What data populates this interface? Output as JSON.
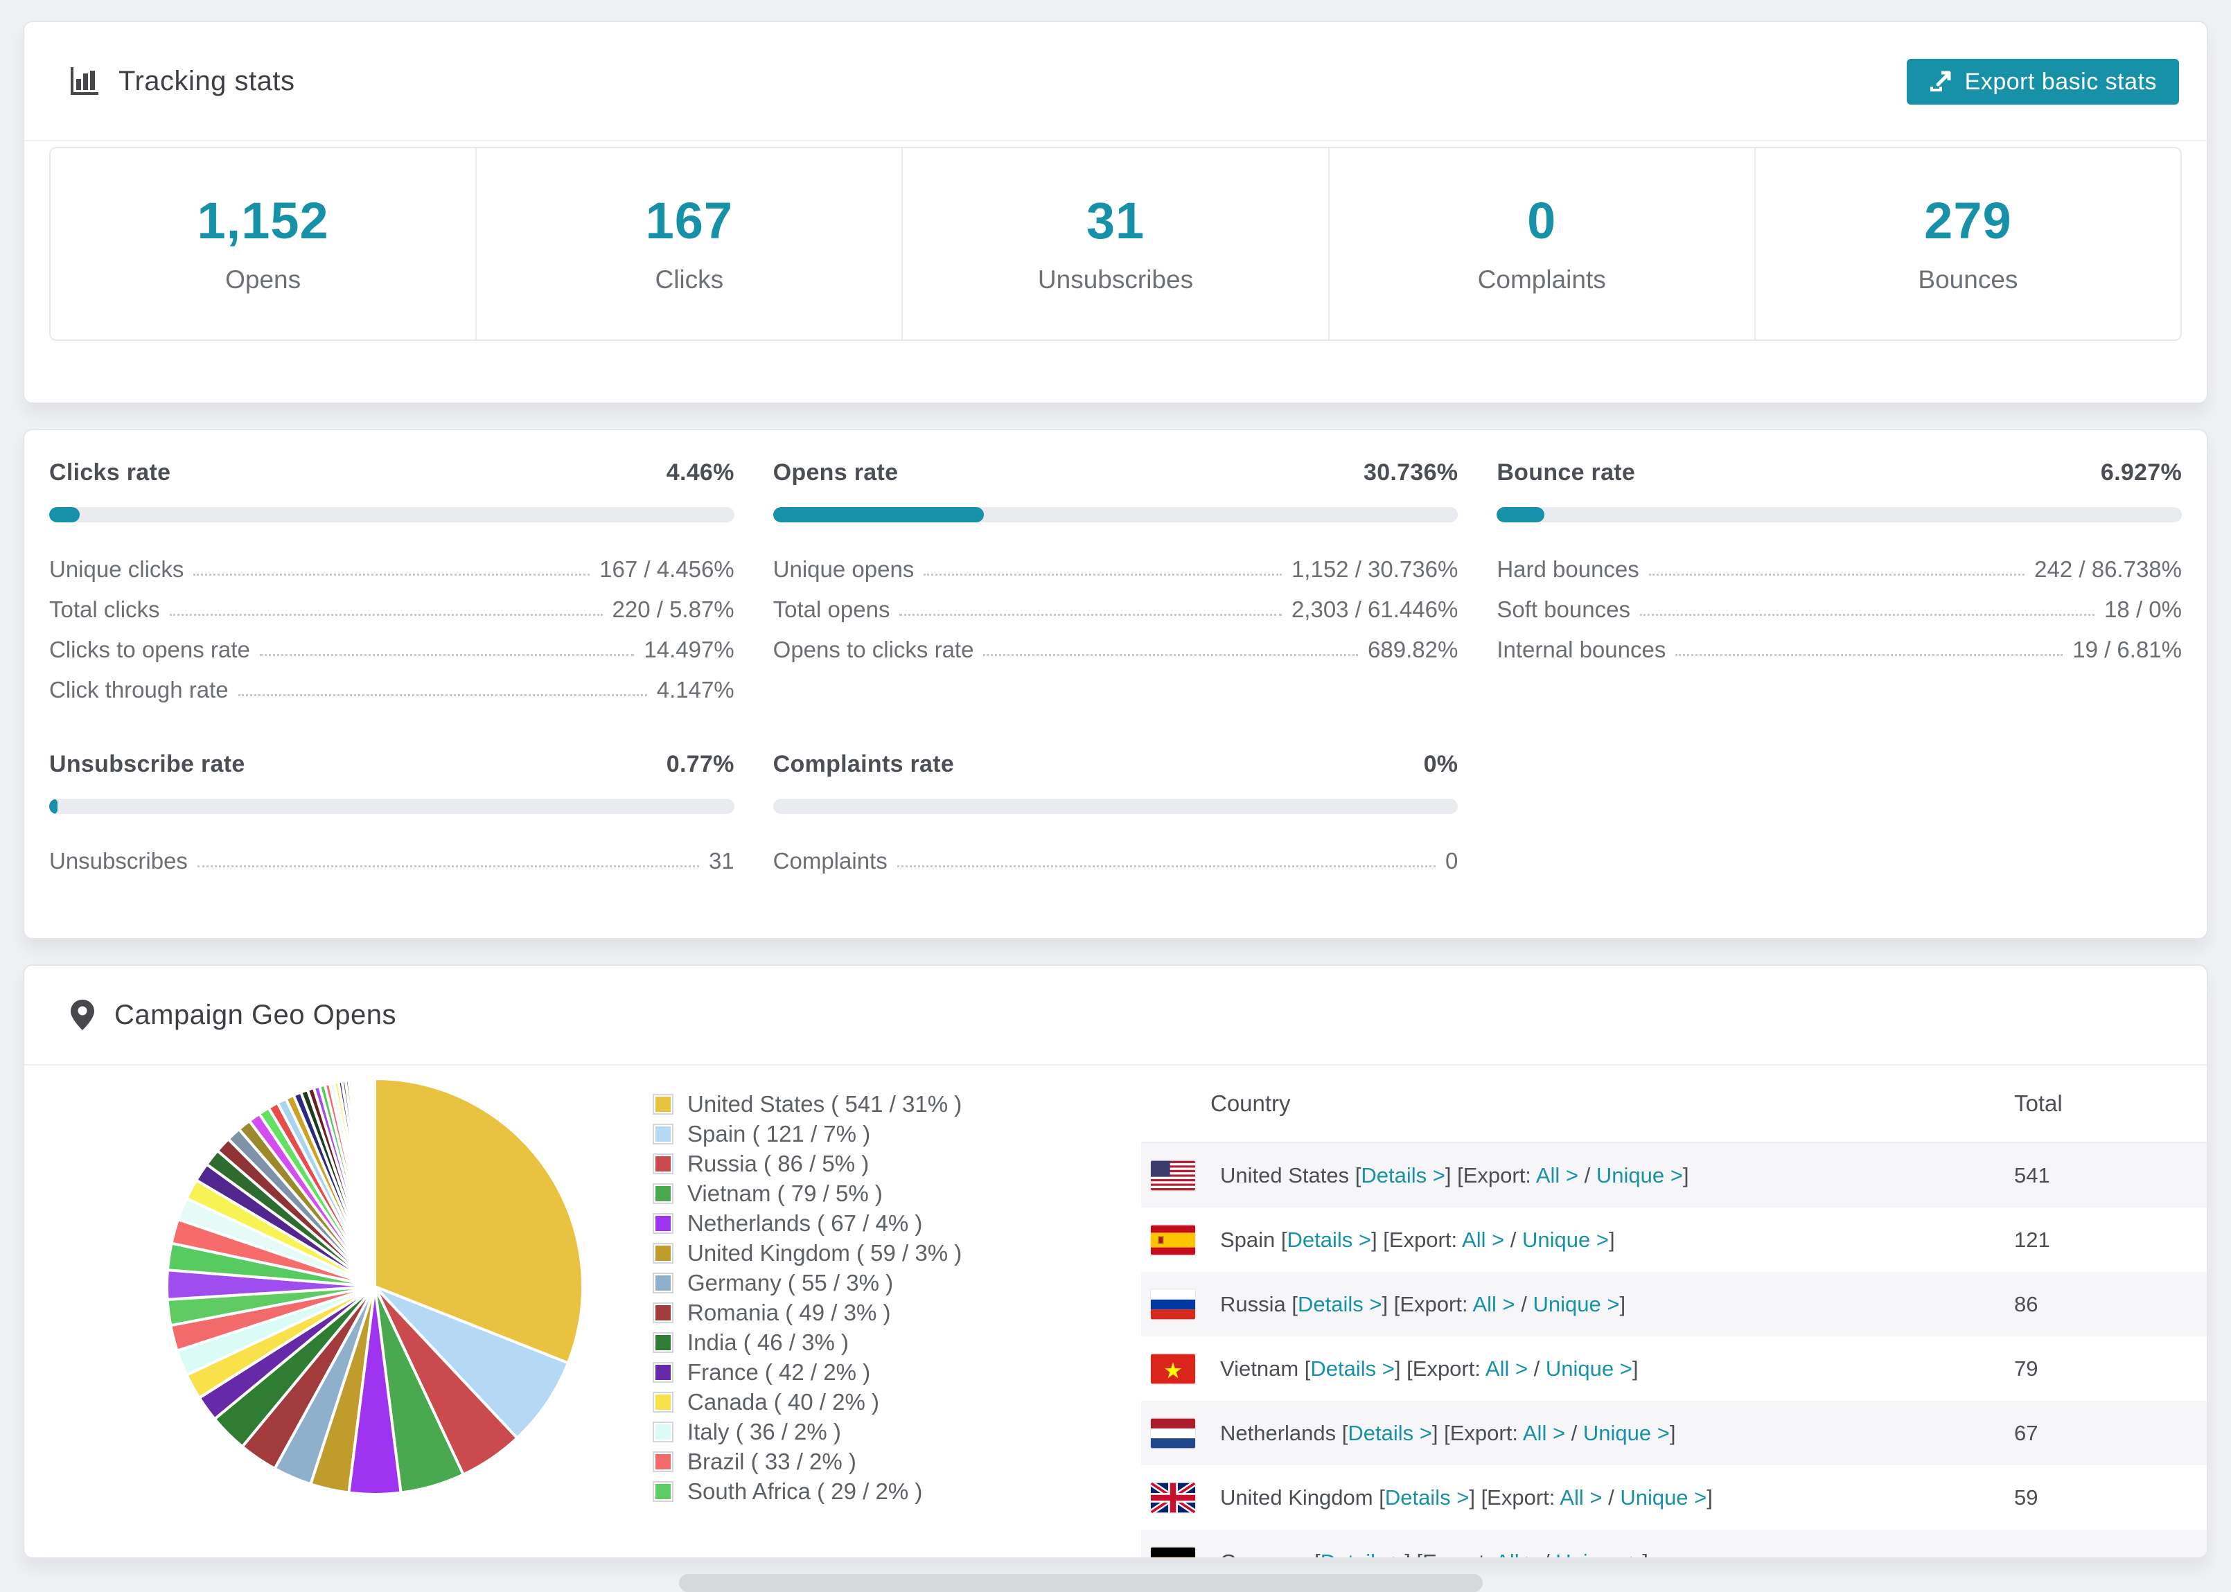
{
  "page": {
    "background": "#f0f1f3",
    "accent": "#1791a8"
  },
  "tracking": {
    "title": "Tracking stats",
    "icon": "bar-chart-icon",
    "export_button": "Export basic stats",
    "stats": [
      {
        "value": "1,152",
        "label": "Opens"
      },
      {
        "value": "167",
        "label": "Clicks"
      },
      {
        "value": "31",
        "label": "Unsubscribes"
      },
      {
        "value": "0",
        "label": "Complaints"
      },
      {
        "value": "279",
        "label": "Bounces"
      }
    ]
  },
  "rates": {
    "blocks": [
      {
        "id": "clicks",
        "title": "Clicks rate",
        "pct": "4.46%",
        "fill": 4.46,
        "rows": [
          [
            "Unique clicks",
            "167 / 4.456%"
          ],
          [
            "Total clicks",
            "220 / 5.87%"
          ],
          [
            "Clicks to opens rate",
            "14.497%"
          ],
          [
            "Click through rate",
            "4.147%"
          ]
        ]
      },
      {
        "id": "opens",
        "title": "Opens rate",
        "pct": "30.736%",
        "fill": 30.736,
        "rows": [
          [
            "Unique opens",
            "1,152 / 30.736%"
          ],
          [
            "Total opens",
            "2,303 / 61.446%"
          ],
          [
            "Opens to clicks rate",
            "689.82%"
          ]
        ]
      },
      {
        "id": "bounce",
        "title": "Bounce rate",
        "pct": "6.927%",
        "fill": 6.927,
        "rows": [
          [
            "Hard bounces",
            "242 / 86.738%"
          ],
          [
            "Soft bounces",
            "18 / 0%"
          ],
          [
            "Internal bounces",
            "19 / 6.81%"
          ]
        ]
      },
      {
        "id": "unsubscribe",
        "title": "Unsubscribe rate",
        "pct": "0.77%",
        "fill": 0.77,
        "rows": [
          [
            "Unsubscribes",
            "31"
          ]
        ]
      },
      {
        "id": "complaints",
        "title": "Complaints rate",
        "pct": "0%",
        "fill": 0,
        "rows": [
          [
            "Complaints",
            "0"
          ]
        ]
      }
    ]
  },
  "geo": {
    "title": "Campaign Geo Opens",
    "icon": "map-pin-icon",
    "table": {
      "col_country": "Country",
      "col_total": "Total",
      "open_bracket": "[",
      "close_bracket": "]",
      "details_label": "Details >",
      "export_prefix": "Export:",
      "all_label": "All >",
      "unique_label": "Unique >",
      "slash": "/",
      "rows": [
        {
          "name": "United States",
          "flag": "us",
          "total": "541"
        },
        {
          "name": "Spain",
          "flag": "es",
          "total": "121"
        },
        {
          "name": "Russia",
          "flag": "ru",
          "total": "86"
        },
        {
          "name": "Vietnam",
          "flag": "vn",
          "total": "79"
        },
        {
          "name": "Netherlands",
          "flag": "nl",
          "total": "67"
        },
        {
          "name": "United Kingdom",
          "flag": "uk",
          "total": "59"
        },
        {
          "name": "Germany",
          "flag": "de",
          "total": "",
          "partial": true
        }
      ]
    }
  },
  "chart_data": {
    "type": "pie",
    "title": "Campaign Geo Opens",
    "legend_position": "right",
    "slices": [
      {
        "label": "United States",
        "count": "541",
        "pct": 31,
        "color": "#e9c23f"
      },
      {
        "label": "Spain",
        "count": "121",
        "pct": 7,
        "color": "#b5d9f5"
      },
      {
        "label": "Russia",
        "count": "86",
        "pct": 5,
        "color": "#cb4a4e"
      },
      {
        "label": "Vietnam",
        "count": "79",
        "pct": 5,
        "color": "#4aa84f"
      },
      {
        "label": "Netherlands",
        "count": "67",
        "pct": 4,
        "color": "#9e33f0"
      },
      {
        "label": "United Kingdom",
        "count": "59",
        "pct": 3,
        "color": "#bf9c2c"
      },
      {
        "label": "Germany",
        "count": "55",
        "pct": 3,
        "color": "#8fb0ca"
      },
      {
        "label": "Romania",
        "count": "49",
        "pct": 3,
        "color": "#a23c3c"
      },
      {
        "label": "India",
        "count": "46",
        "pct": 3,
        "color": "#2e7d32"
      },
      {
        "label": "France",
        "count": "42",
        "pct": 2,
        "color": "#6629a8"
      },
      {
        "label": "Canada",
        "count": "40",
        "pct": 2,
        "color": "#f8e14b"
      },
      {
        "label": "Italy",
        "count": "36",
        "pct": 2,
        "color": "#dbfcf6"
      },
      {
        "label": "Brazil",
        "count": "33",
        "pct": 2,
        "color": "#f36a6a"
      },
      {
        "label": "South Africa",
        "count": "29",
        "pct": 2,
        "color": "#5ecb63"
      }
    ],
    "others": {
      "total_pct": 26,
      "count": 42,
      "decay": 0.915,
      "colors": [
        "#a04df0",
        "#58cb60",
        "#f76b6b",
        "#e6fbf7",
        "#f7f355",
        "#51268f",
        "#2e6b2e",
        "#8e3434",
        "#7e93a8",
        "#9b8a2c",
        "#d44df0",
        "#63e063",
        "#e84b4b",
        "#a8d4f0",
        "#c9a227",
        "#2a2a80",
        "#1c3d1c",
        "#6b1f1f"
      ]
    }
  }
}
